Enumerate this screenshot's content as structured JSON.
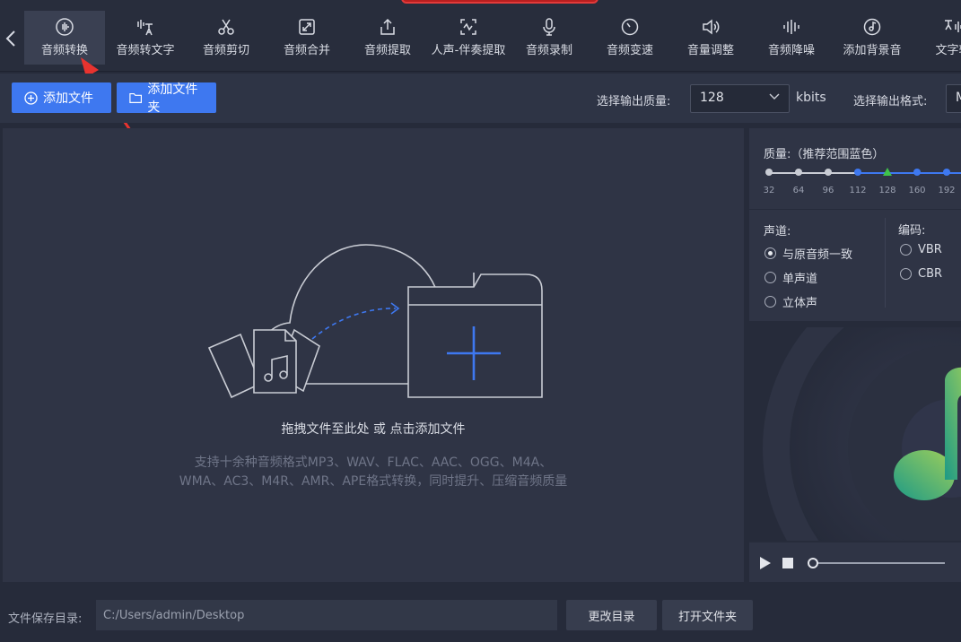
{
  "nav": {
    "items": [
      {
        "label": "音频转换",
        "icon": "audio-wave-icon"
      },
      {
        "label": "音频转文字",
        "icon": "speech-to-text-icon"
      },
      {
        "label": "音频剪切",
        "icon": "scissors-icon"
      },
      {
        "label": "音频合并",
        "icon": "merge-icon"
      },
      {
        "label": "音频提取",
        "icon": "export-icon"
      },
      {
        "label": "人声-伴奏提取",
        "icon": "vocal-icon"
      },
      {
        "label": "音频录制",
        "icon": "microphone-icon"
      },
      {
        "label": "音频变速",
        "icon": "speed-icon"
      },
      {
        "label": "音量调整",
        "icon": "volume-icon"
      },
      {
        "label": "音频降噪",
        "icon": "denoise-icon"
      },
      {
        "label": "添加背景音",
        "icon": "music-disc-icon"
      },
      {
        "label": "文字转",
        "icon": "text-to-speech-icon"
      }
    ],
    "active_index": 0
  },
  "toolbar": {
    "add_file": "添加文件",
    "add_folder": "添加文件夹",
    "quality_label": "选择输出质量:",
    "quality_value": "128",
    "quality_unit": "kbits",
    "format_label": "选择输出格式:",
    "format_value": "M"
  },
  "drop": {
    "main_text": "拖拽文件至此处 或 点击添加文件",
    "sub_line1": "支持十余种音频格式MP3、WAV、FLAC、AAC、OGG、M4A、",
    "sub_line2": "WMA、AC3、M4R、AMR、APE格式转换，同时提升、压缩音频质量"
  },
  "quality_panel": {
    "title": "质量:（推荐范围蓝色）",
    "ticks": [
      "32",
      "64",
      "96",
      "112",
      "128",
      "160",
      "192"
    ],
    "selected": "128",
    "colors": {
      "gray": "#c9ccd4",
      "blue": "#3e78f0",
      "green": "#3fc24a"
    }
  },
  "channel": {
    "label": "声道:",
    "options": [
      "与原音频一致",
      "单声道",
      "立体声"
    ],
    "selected_index": 0
  },
  "encoding": {
    "label": "编码:",
    "options": [
      "VBR",
      "CBR"
    ]
  },
  "player": {
    "progress": 0
  },
  "footer": {
    "save_label": "文件保存目录:",
    "path": "C:/Users/admin/Desktop",
    "change_dir": "更改目录",
    "open_folder": "打开文件夹"
  }
}
